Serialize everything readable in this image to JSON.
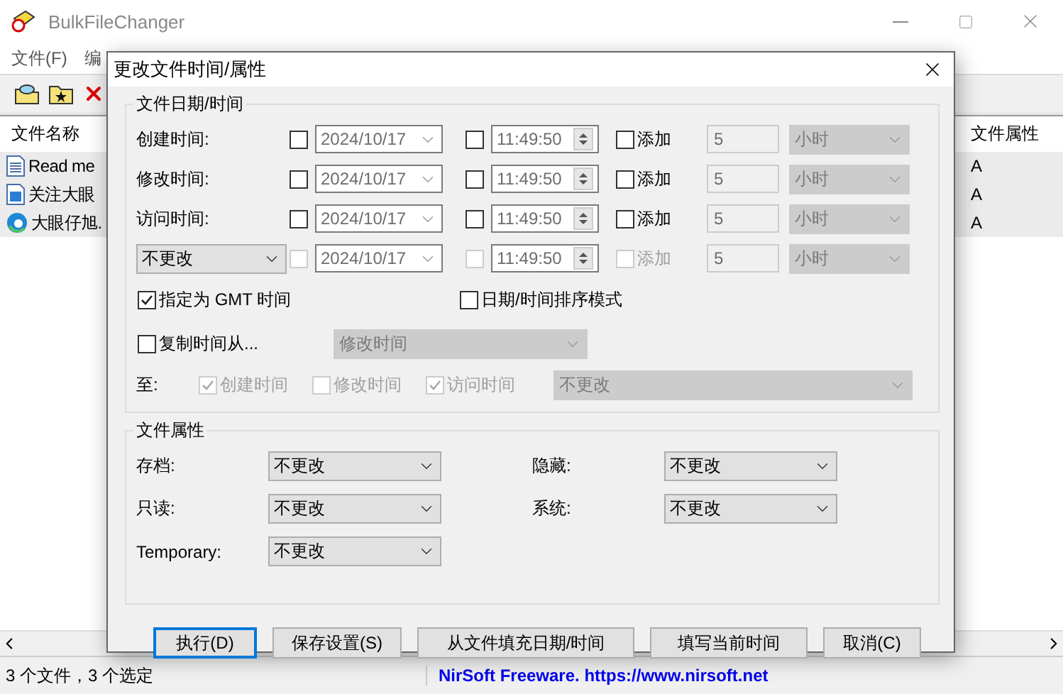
{
  "window": {
    "title": "BulkFileChanger"
  },
  "menu": [
    {
      "label": "文件(F)"
    },
    {
      "label": "编"
    }
  ],
  "toolbar": [
    {
      "kind": "open"
    },
    {
      "kind": "star-folder"
    },
    {
      "kind": "delete"
    }
  ],
  "list": {
    "columns": [
      "文件名称",
      "文件属性"
    ],
    "rows": [
      {
        "name": "Read me",
        "kind": "text",
        "attr": "A",
        "selected": true
      },
      {
        "name": "关注大眼",
        "kind": "image",
        "attr": "A",
        "selected": true
      },
      {
        "name": "大眼仔旭.",
        "kind": "web",
        "attr": "A",
        "selected": true
      }
    ]
  },
  "status_bar": [
    "3 个文件，3 个选定",
    "NirSoft Freeware. https://www.nirsoft.net"
  ],
  "dialog": {
    "title": "更改文件时间/属性",
    "date_group": {
      "title": "文件日期/时间",
      "rows": [
        {
          "kind": "label",
          "label": "创建时间:",
          "enabled": true,
          "date_checked": false,
          "date": "2024/10/17",
          "time_checked": false,
          "time": "11:49:50",
          "add_checked": false,
          "add_label": "添加",
          "amount": "5",
          "unit": "小时"
        },
        {
          "kind": "label",
          "label": "修改时间:",
          "enabled": true,
          "date_checked": false,
          "date": "2024/10/17",
          "time_checked": false,
          "time": "11:49:50",
          "add_checked": false,
          "add_label": "添加",
          "amount": "5",
          "unit": "小时"
        },
        {
          "kind": "label",
          "label": "访问时间:",
          "enabled": true,
          "date_checked": false,
          "date": "2024/10/17",
          "time_checked": false,
          "time": "11:49:50",
          "add_checked": false,
          "add_label": "添加",
          "amount": "5",
          "unit": "小时"
        },
        {
          "kind": "select",
          "label": "不更改",
          "enabled": false,
          "date_checked": false,
          "date": "2024/10/17",
          "time_checked": false,
          "time": "11:49:50",
          "add_checked": false,
          "add_label": "添加",
          "amount": "5",
          "unit": "小时"
        }
      ],
      "gmt": {
        "label": "指定为 GMT 时间",
        "checked": true
      },
      "sort_mode": {
        "label": "日期/时间排序模式",
        "checked": false
      },
      "copy_from": {
        "label": "复制时间从...",
        "checked": false,
        "value": "修改时间"
      },
      "to": {
        "label": "至:",
        "targets": [
          {
            "label": "创建时间",
            "checked": true
          },
          {
            "label": "修改时间",
            "checked": false
          },
          {
            "label": "访问时间",
            "checked": true
          }
        ],
        "value": "不更改"
      }
    },
    "attr_group": {
      "title": "文件属性",
      "items": [
        {
          "label": "存档:",
          "value": "不更改"
        },
        {
          "label": "隐藏:",
          "value": "不更改"
        },
        {
          "label": "只读:",
          "value": "不更改"
        },
        {
          "label": "系统:",
          "value": "不更改"
        },
        {
          "label": "Temporary:",
          "value": "不更改"
        }
      ]
    },
    "buttons": [
      {
        "label": "执行(D)",
        "selected": true
      },
      {
        "label": "保存设置(S)",
        "selected": false
      },
      {
        "label": "从文件填充日期/时间",
        "selected": false
      },
      {
        "label": "填写当前时间",
        "selected": false
      },
      {
        "label": "取消(C)",
        "selected": false
      }
    ]
  }
}
